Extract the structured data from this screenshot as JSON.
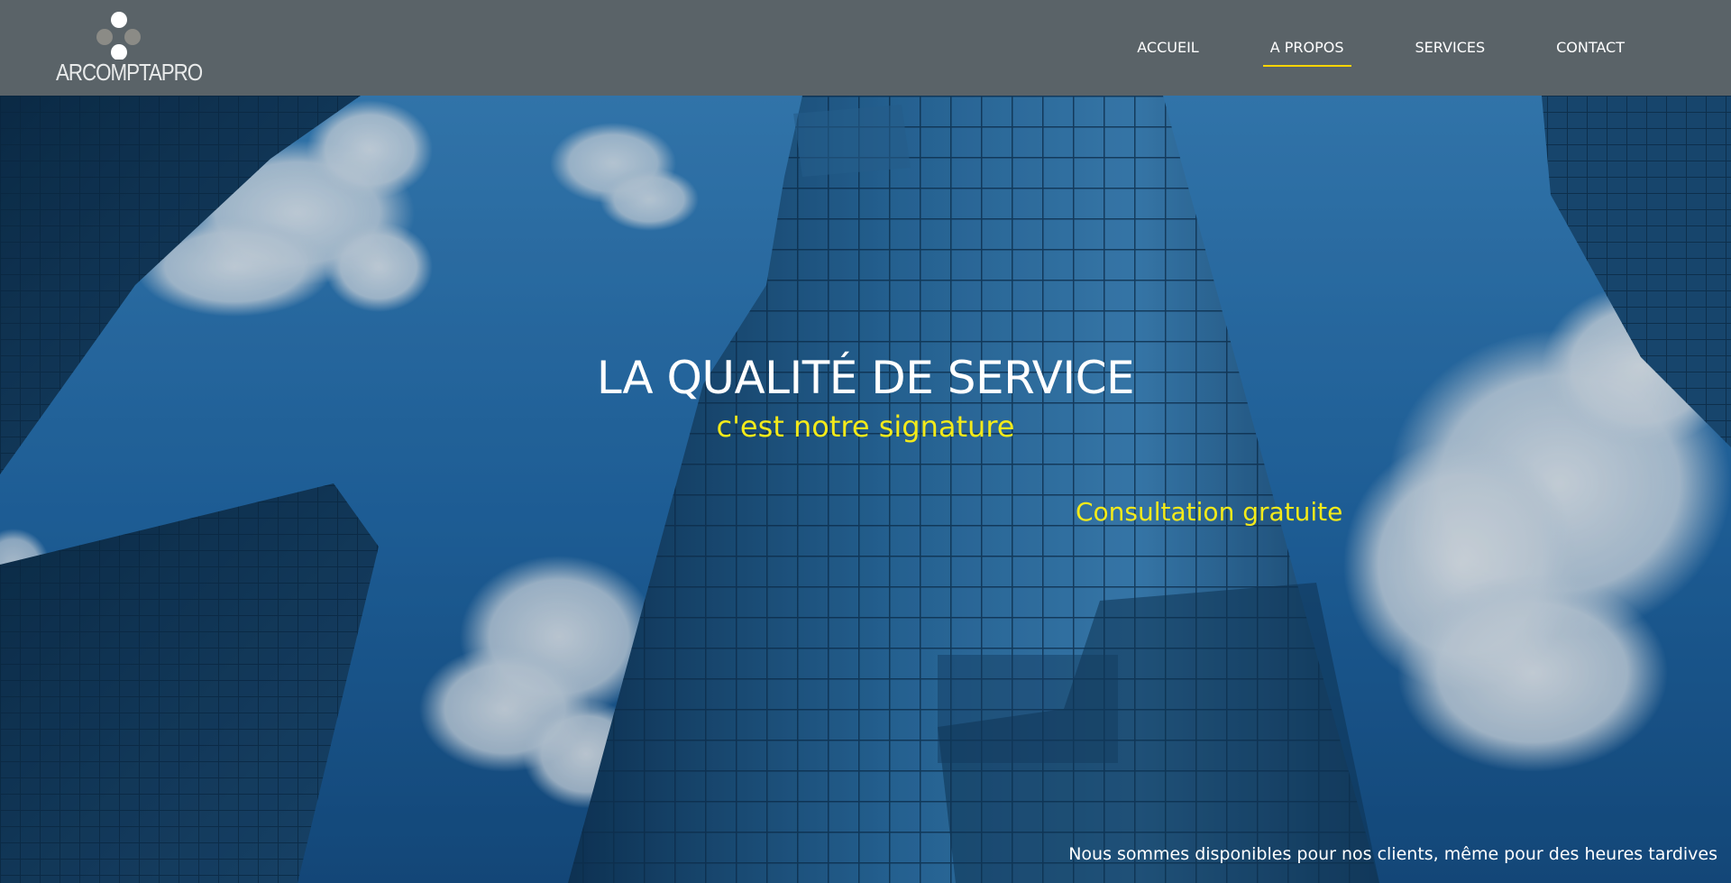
{
  "header": {
    "logo_text": "ARCOMPTAPRO",
    "nav": [
      {
        "label": "ACCUEIL",
        "active": false
      },
      {
        "label": "A PROPOS",
        "active": true
      },
      {
        "label": "SERVICES",
        "active": false
      },
      {
        "label": "CONTACT",
        "active": false
      }
    ]
  },
  "hero": {
    "title": "LA QUALITÉ DE SERVICE",
    "subtitle": "c'est notre signature",
    "cta": "Consultation gratuite",
    "note": "Nous sommes disponibles pour nos clients, même pour des heures tardives"
  },
  "colors": {
    "header_bg": "#5a6368",
    "accent_yellow": "#f3ea1a",
    "nav_underline": "#ffd400",
    "sky": "#2a73b4"
  }
}
